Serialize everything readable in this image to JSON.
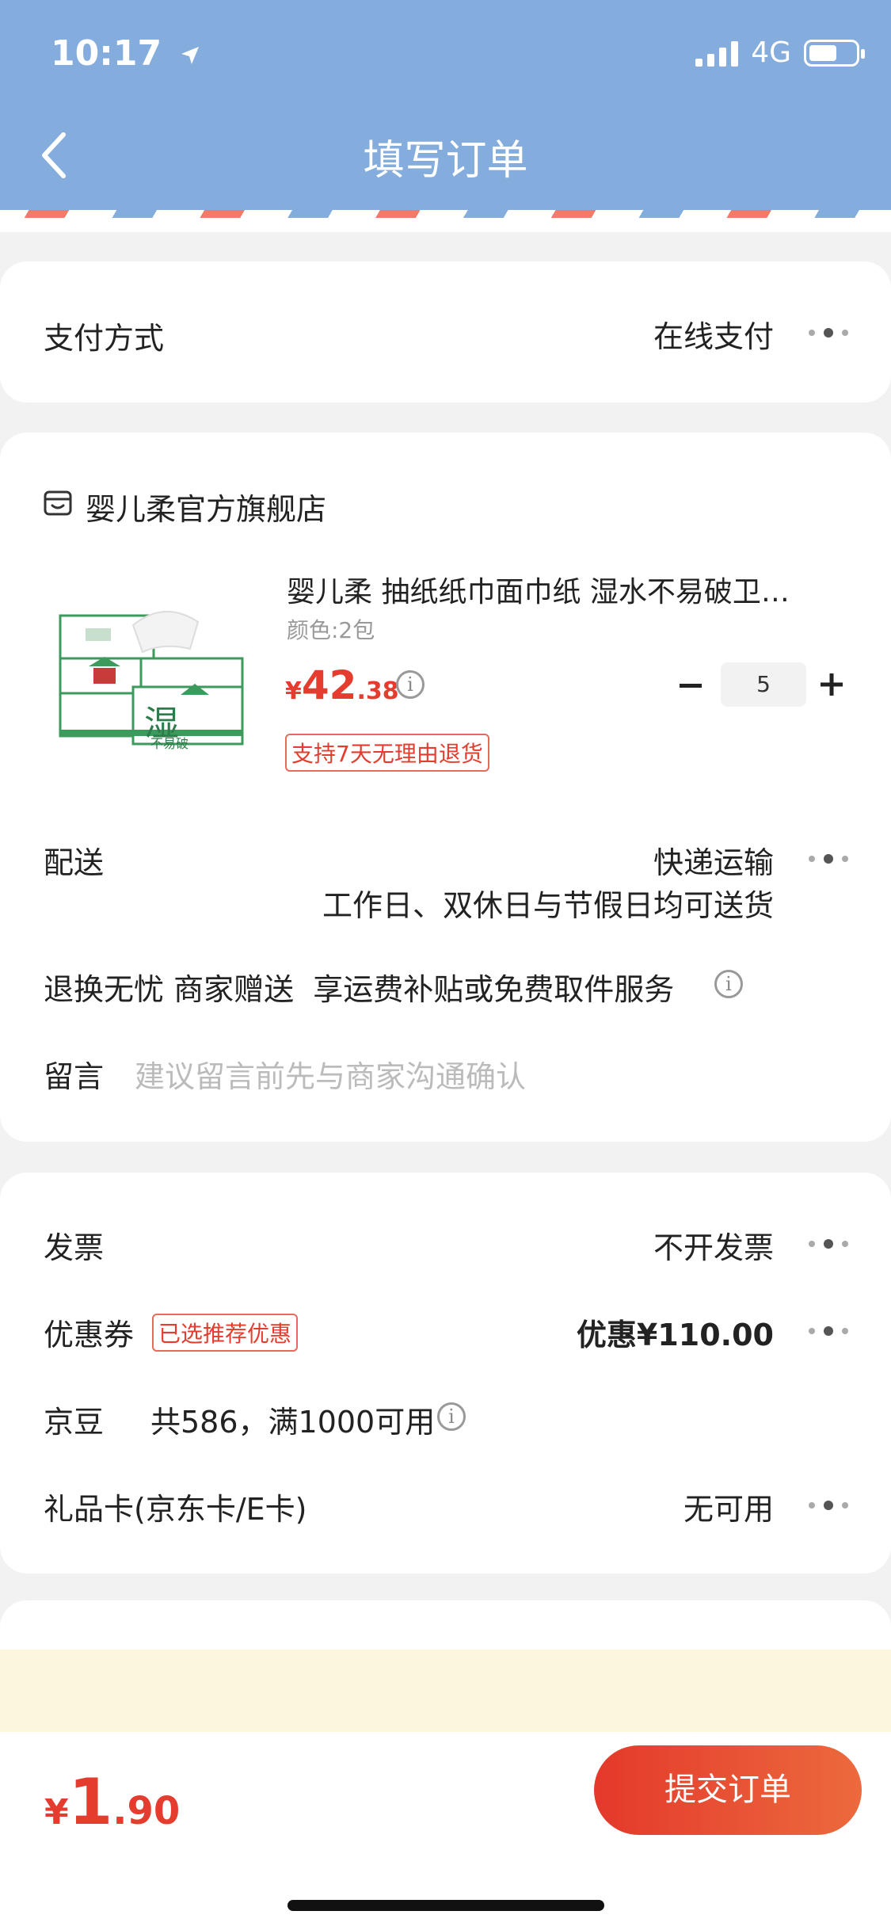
{
  "status": {
    "time": "10:17",
    "network": "4G"
  },
  "nav": {
    "title": "填写订单"
  },
  "payment": {
    "label": "支付方式",
    "value": "在线支付"
  },
  "store": {
    "name": "婴儿柔官方旗舰店",
    "product": {
      "title": "婴儿柔 抽纸纸巾面巾纸  湿水不易破卫…",
      "spec": "颜色:2包",
      "currency": "¥",
      "price_int": "42",
      "price_dec": ".38",
      "quantity": "5",
      "return_tag": "支持7天无理由退货",
      "image_text": "湿",
      "image_subtext": "不易破"
    },
    "delivery": {
      "label": "配送",
      "method": "快递运输",
      "note": "工作日、双休日与节假日均可送货"
    },
    "worry_free": "退换无忧 商家赠送  享运费补贴或免费取件服务",
    "message": {
      "label": "留言",
      "placeholder": "建议留言前先与商家沟通确认"
    }
  },
  "benefits": {
    "invoice": {
      "label": "发票",
      "value": "不开发票"
    },
    "coupon": {
      "label": "优惠券",
      "badge": "已选推荐优惠",
      "value": "优惠¥110.00"
    },
    "jd_beans": {
      "label": "京豆",
      "value": "共586，满1000可用"
    },
    "gift_card": {
      "label": "礼品卡(京东卡/E卡)",
      "value": "无可用"
    }
  },
  "footer": {
    "currency": "¥",
    "total_int": "1",
    "total_dec": ".90",
    "submit_label": "提交订单"
  },
  "colors": {
    "nav_bg": "#84acdc",
    "accent": "#e43d2f",
    "tips_bg": "#fbf7dc"
  }
}
